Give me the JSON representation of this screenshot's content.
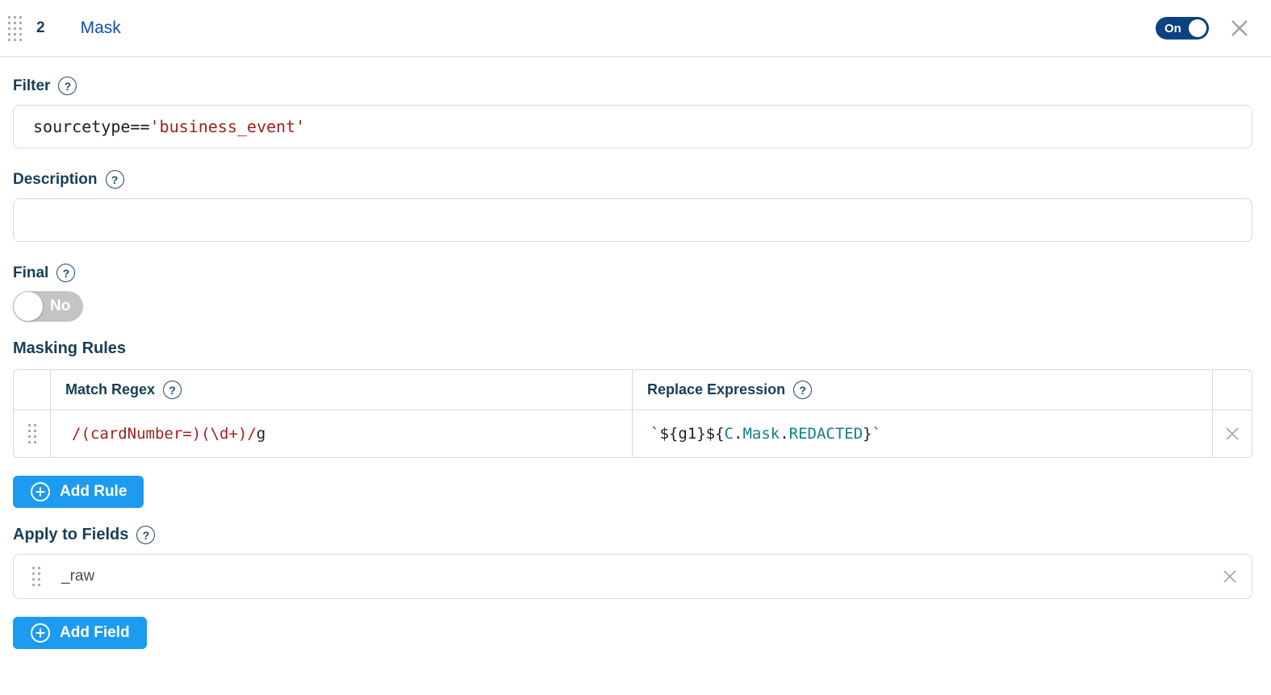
{
  "header": {
    "index": "2",
    "title": "Mask",
    "enabled_toggle": {
      "label": "On",
      "state": "on",
      "color": "#0b4280"
    },
    "close_icon": "x"
  },
  "filter": {
    "label": "Filter",
    "value": "sourcetype=='business_event'",
    "segments": [
      {
        "text": "sourcetype==",
        "color": "default"
      },
      {
        "text": "'business_event'",
        "color": "red"
      }
    ]
  },
  "description": {
    "label": "Description",
    "value": "",
    "placeholder": ""
  },
  "final": {
    "label": "Final",
    "toggle_label": "No",
    "state": "off"
  },
  "masking_rules": {
    "heading": "Masking Rules",
    "columns": [
      {
        "label": "Match Regex"
      },
      {
        "label": "Replace Expression"
      }
    ],
    "rows": [
      {
        "match_regex": "/(cardNumber=)(\\d+)/g",
        "match_segments": [
          {
            "text": "/(cardNumber=)(\\d+)/",
            "color": "red"
          },
          {
            "text": "g",
            "color": "default"
          }
        ],
        "replace_expression": "`${g1}${C.Mask.REDACTED}`",
        "replace_segments": [
          {
            "text": "`",
            "color": "red"
          },
          {
            "text": "${g1}${",
            "color": "default"
          },
          {
            "text": "C",
            "color": "teal"
          },
          {
            "text": ".",
            "color": "default"
          },
          {
            "text": "Mask",
            "color": "teal"
          },
          {
            "text": ".",
            "color": "default"
          },
          {
            "text": "REDACTED",
            "color": "teal"
          },
          {
            "text": "}",
            "color": "default"
          },
          {
            "text": "`",
            "color": "red"
          }
        ]
      }
    ],
    "add_button_label": "Add Rule"
  },
  "apply_to_fields": {
    "label": "Apply to Fields",
    "fields": [
      {
        "value": "_raw"
      }
    ],
    "add_button_label": "Add Field"
  },
  "icons": {
    "help": "?"
  },
  "colors": {
    "label_navy": "#173e57",
    "title_blue": "#0d4fae",
    "toggle_on_navy": "#0b4280",
    "toggle_off_gray": "#c4c4c6",
    "button_blue": "#1d9bf0",
    "code_red": "#9e2121",
    "code_teal": "#0f7f8b",
    "border_gray": "#d6dade"
  }
}
